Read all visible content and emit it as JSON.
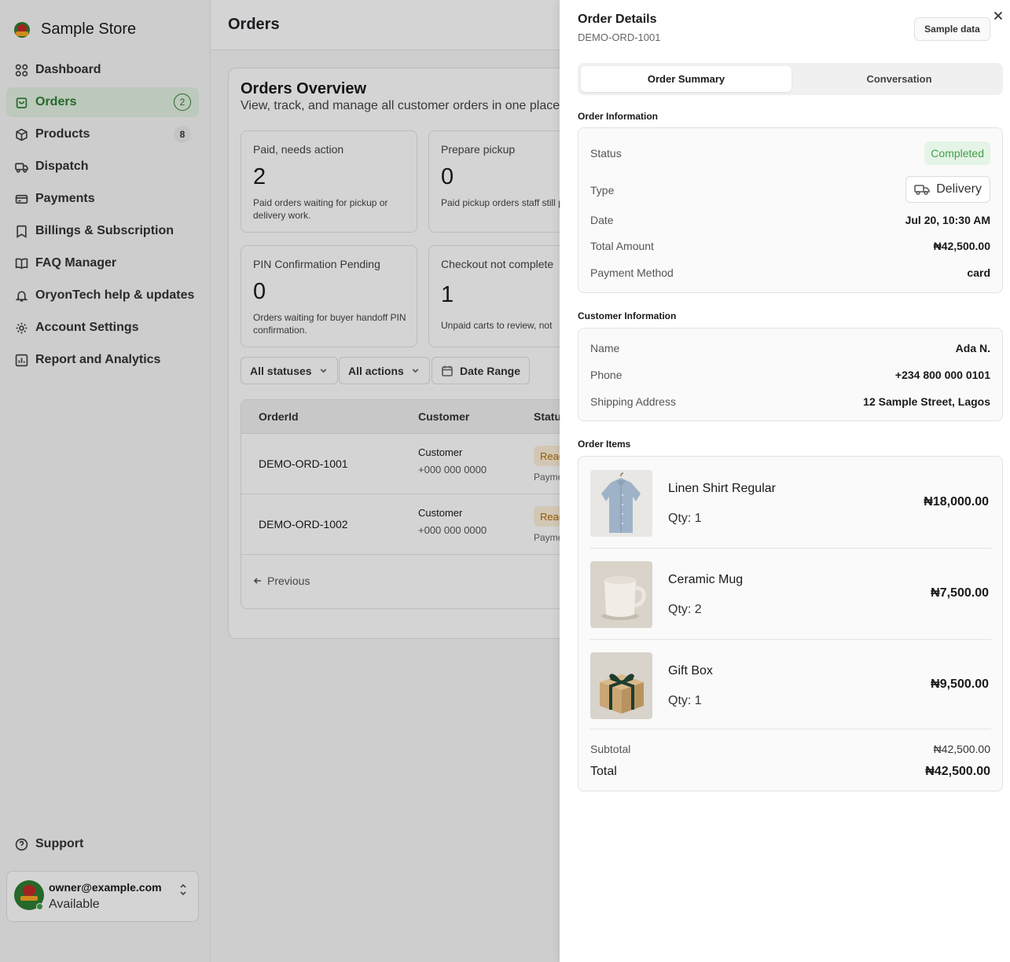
{
  "sidebar": {
    "brand": "Sample Store",
    "items": [
      {
        "label": "Dashboard",
        "icon": "grid-icon"
      },
      {
        "label": "Orders",
        "icon": "bag-icon",
        "badge": "2"
      },
      {
        "label": "Products",
        "icon": "box-icon",
        "badge": "8"
      },
      {
        "label": "Dispatch",
        "icon": "truck-icon"
      },
      {
        "label": "Payments",
        "icon": "card-icon"
      },
      {
        "label": "Billings & Subscription",
        "icon": "bookmark-icon"
      },
      {
        "label": "FAQ Manager",
        "icon": "book-icon"
      },
      {
        "label": "OryonTech help & updates",
        "icon": "bell-icon"
      },
      {
        "label": "Account Settings",
        "icon": "gear-icon"
      },
      {
        "label": "Report and Analytics",
        "icon": "chart-icon"
      }
    ],
    "support": "Support",
    "user": {
      "email": "owner@example.com",
      "status": "Available"
    }
  },
  "main": {
    "title": "Orders",
    "overview": {
      "title": "Orders Overview",
      "subtitle": "View, track, and manage all customer orders in one place."
    },
    "stats": [
      {
        "label": "Paid, needs action",
        "value": "2",
        "desc": "Paid orders waiting for pickup or delivery work."
      },
      {
        "label": "Prepare pickup",
        "value": "0",
        "desc": "Paid pickup orders staff still prepare."
      },
      {
        "label": "PIN Confirmation Pending",
        "value": "0",
        "desc": "Orders waiting for buyer handoff PIN confirmation."
      },
      {
        "label": "Checkout not complete",
        "value": "1",
        "desc": "Unpaid carts to review, not"
      }
    ],
    "filters": {
      "statuses": "All statuses",
      "actions": "All actions",
      "date_range": "Date Range"
    },
    "table": {
      "columns": [
        "OrderId",
        "Customer",
        "Statu"
      ],
      "rows": [
        {
          "id": "DEMO-ORD-1001",
          "customer": "Customer",
          "phone": "+000 000 0000",
          "status": "Read",
          "payment": "Payme"
        },
        {
          "id": "DEMO-ORD-1002",
          "customer": "Customer",
          "phone": "+000 000 0000",
          "status": "Read",
          "payment": "Payme"
        }
      ],
      "previous": "Previous"
    }
  },
  "drawer": {
    "title": "Order Details",
    "order_id": "DEMO-ORD-1001",
    "sample_button": "Sample data",
    "tabs": [
      "Order Summary",
      "Conversation"
    ],
    "order_info": {
      "section": "Order Information",
      "status_label": "Status",
      "status_value": "Completed",
      "type_label": "Type",
      "type_value": "Delivery",
      "date_label": "Date",
      "date_value": "Jul 20, 10:30 AM",
      "amount_label": "Total Amount",
      "amount_value": "₦42,500.00",
      "method_label": "Payment Method",
      "method_value": "card"
    },
    "customer_info": {
      "section": "Customer Information",
      "name_label": "Name",
      "name_value": "Ada N.",
      "phone_label": "Phone",
      "phone_value": "+234 800 000 0101",
      "address_label": "Shipping Address",
      "address_value": "12 Sample Street, Lagos"
    },
    "items": {
      "section": "Order Items",
      "list": [
        {
          "name": "Linen Shirt Regular",
          "qty": "Qty: 1",
          "price": "₦18,000.00"
        },
        {
          "name": "Ceramic Mug",
          "qty": "Qty: 2",
          "price": "₦7,500.00"
        },
        {
          "name": "Gift Box",
          "qty": "Qty: 1",
          "price": "₦9,500.00"
        }
      ],
      "subtotal_label": "Subtotal",
      "subtotal_value": "₦42,500.00",
      "total_label": "Total",
      "total_value": "₦42,500.00"
    }
  },
  "colors": {
    "accent": "#2e7d32",
    "completed_bg": "#e4f4e6",
    "completed_text": "#43a047"
  }
}
